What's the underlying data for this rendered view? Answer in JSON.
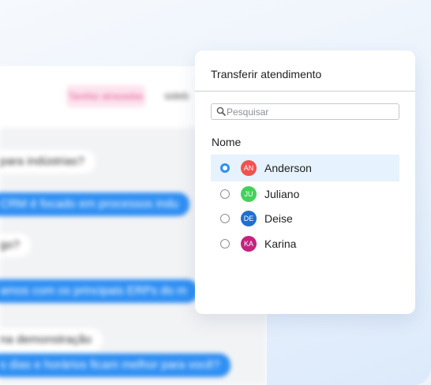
{
  "background_chat": {
    "tag_label": "Tarefas atrasadas",
    "top_text": "sideb",
    "messages": [
      {
        "text": "para indústrias?",
        "direction": "in"
      },
      {
        "text": "CRM é focado em processos indu",
        "direction": "out"
      },
      {
        "text": "go?",
        "direction": "in"
      },
      {
        "text": "amos com os principais ERPs do m",
        "direction": "out"
      },
      {
        "text": "na demonstração",
        "direction": "in"
      },
      {
        "text": "s dias e horários ficam melhor para você?",
        "direction": "out"
      }
    ]
  },
  "modal": {
    "title": "Transferir atendimento",
    "search_placeholder": "Pesquisar",
    "search_value": "",
    "column_header": "Nome",
    "selected_index": 0,
    "agents": [
      {
        "initials": "AN",
        "name": "Anderson",
        "color": "#ef5350"
      },
      {
        "initials": "JU",
        "name": "Juliano",
        "color": "#43d159"
      },
      {
        "initials": "DE",
        "name": "Deise",
        "color": "#1f6fd1"
      },
      {
        "initials": "KA",
        "name": "Karina",
        "color": "#c2247e"
      }
    ]
  },
  "colors": {
    "accent": "#2f8ff3",
    "selected_row": "#e6f2fd",
    "tag_bg": "#fde3ee"
  }
}
